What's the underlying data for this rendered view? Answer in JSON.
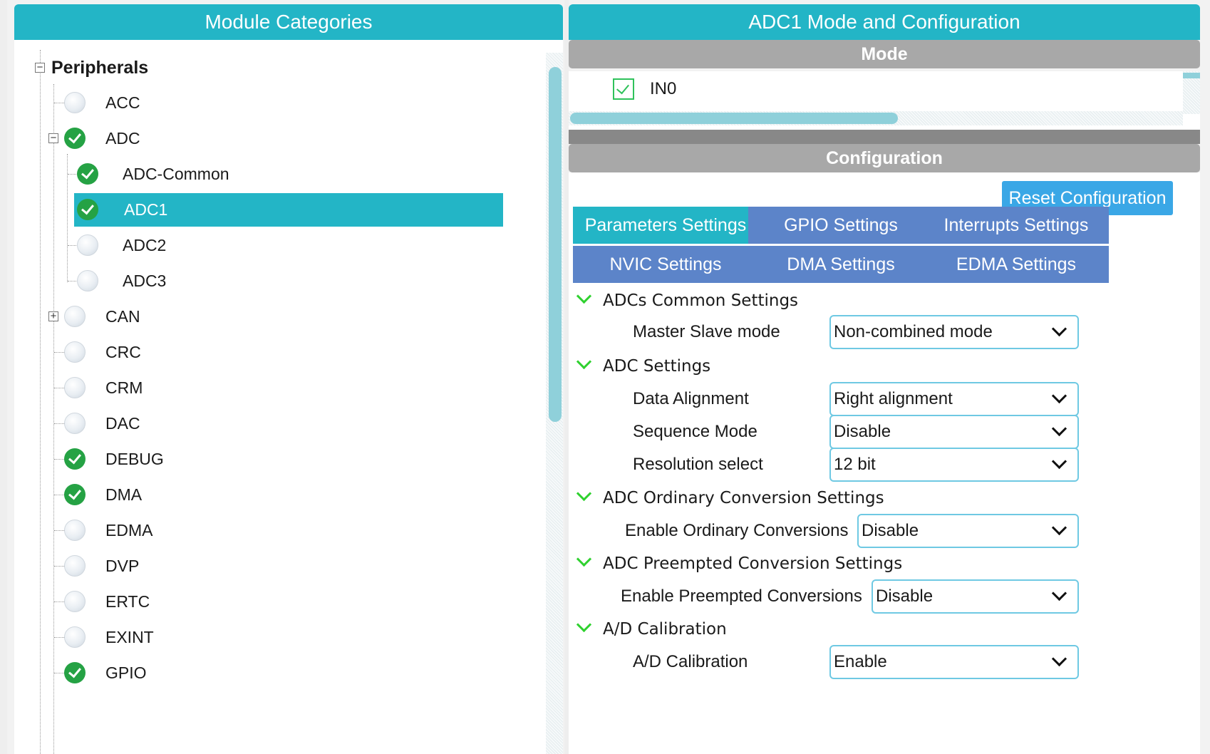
{
  "left": {
    "title": "Module Categories",
    "root_label": "Peripherals",
    "items": [
      {
        "label": "ACC",
        "enabled": false
      },
      {
        "label": "ADC",
        "enabled": true
      },
      {
        "label": "ADC-Common",
        "enabled": true
      },
      {
        "label": "ADC1",
        "enabled": true,
        "selected": true
      },
      {
        "label": "ADC2",
        "enabled": false
      },
      {
        "label": "ADC3",
        "enabled": false
      },
      {
        "label": "CAN",
        "enabled": false
      },
      {
        "label": "CRC",
        "enabled": false
      },
      {
        "label": "CRM",
        "enabled": false
      },
      {
        "label": "DAC",
        "enabled": false
      },
      {
        "label": "DEBUG",
        "enabled": true
      },
      {
        "label": "DMA",
        "enabled": true
      },
      {
        "label": "EDMA",
        "enabled": false
      },
      {
        "label": "DVP",
        "enabled": false
      },
      {
        "label": "ERTC",
        "enabled": false
      },
      {
        "label": "EXINT",
        "enabled": false
      },
      {
        "label": "GPIO",
        "enabled": true
      }
    ]
  },
  "right": {
    "title": "ADC1 Mode and Configuration",
    "mode_title": "Mode",
    "mode_items": [
      {
        "label": "IN0",
        "checked": true
      }
    ],
    "config_title": "Configuration",
    "reset_label": "Reset Configuration",
    "tabs": [
      {
        "label": "Parameters Settings",
        "active": true
      },
      {
        "label": "GPIO Settings"
      },
      {
        "label": "Interrupts Settings"
      },
      {
        "label": "NVIC Settings"
      },
      {
        "label": "DMA Settings"
      },
      {
        "label": "EDMA Settings"
      }
    ],
    "sections": [
      {
        "title": "ADCs Common Settings",
        "params": [
          {
            "label": "Master Slave mode",
            "value": "Non-combined mode"
          }
        ]
      },
      {
        "title": "ADC Settings",
        "params": [
          {
            "label": "Data Alignment",
            "value": "Right alignment"
          },
          {
            "label": "Sequence Mode",
            "value": "Disable"
          },
          {
            "label": "Resolution select",
            "value": "12 bit"
          }
        ]
      },
      {
        "title": "ADC Ordinary Conversion Settings",
        "params": [
          {
            "label": "Enable Ordinary Conversions",
            "value": "Disable"
          }
        ]
      },
      {
        "title": "ADC Preempted Conversion Settings",
        "params": [
          {
            "label": "Enable Preempted Conversions",
            "value": "Disable"
          }
        ]
      },
      {
        "title": "A/D Calibration",
        "params": [
          {
            "label": "A/D Calibration",
            "value": "Enable"
          }
        ]
      }
    ]
  },
  "colors": {
    "header_teal": "#23b5c6",
    "tab_blue": "#5c84c9",
    "reset_blue": "#3aa7e6",
    "status_green": "#25a244",
    "mode_bar_gray": "#a8a8a8"
  }
}
